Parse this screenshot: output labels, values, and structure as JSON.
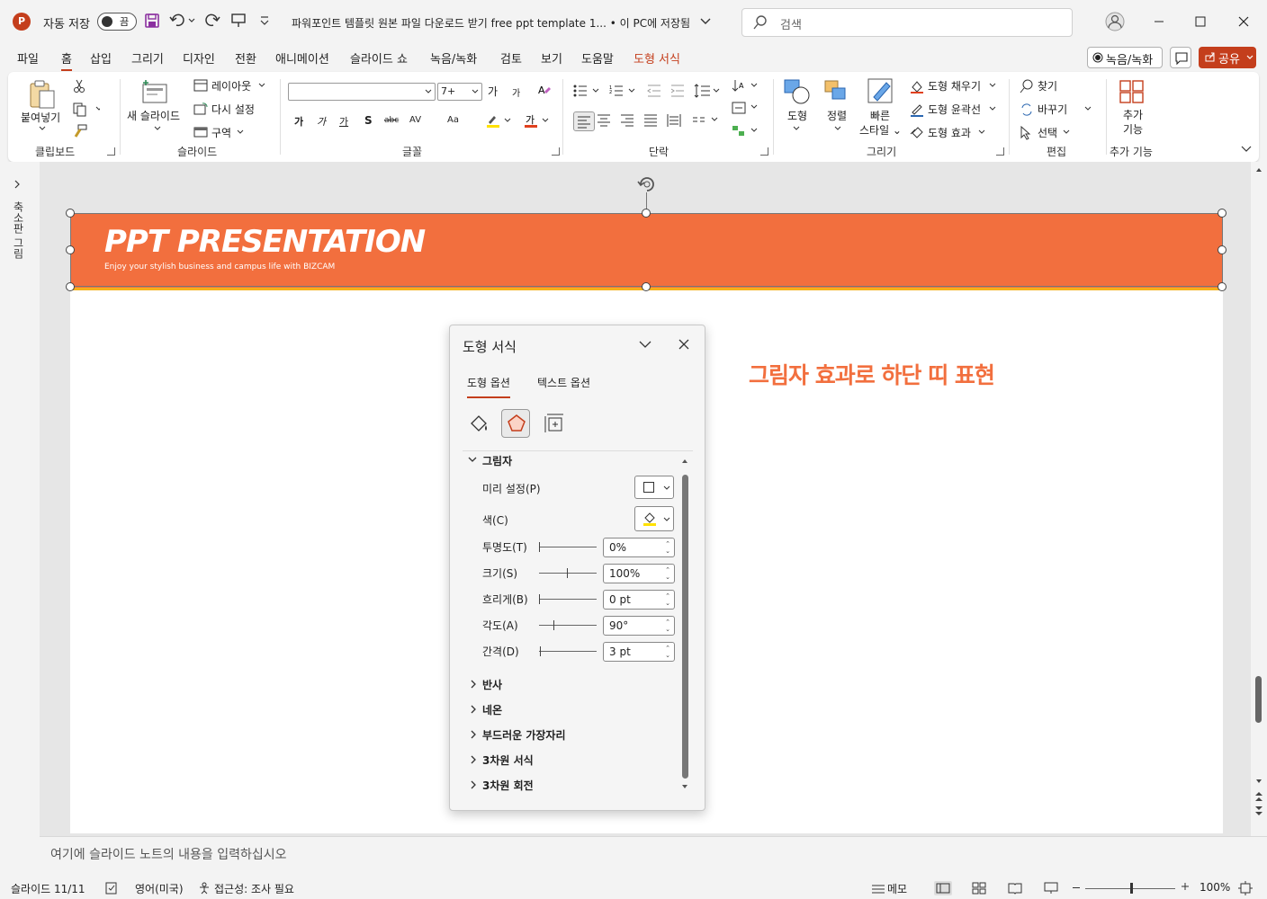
{
  "titlebar": {
    "app_icon": "P",
    "autosave_label": "자동 저장",
    "autosave_state": "끔",
    "doc_title": "파워포인트 템플릿 원본 파일 다운로드 받기 free ppt template 1... • 이 PC에 저장됨",
    "search_placeholder": "검색"
  },
  "menu": {
    "tabs": [
      "파일",
      "홈",
      "삽입",
      "그리기",
      "디자인",
      "전환",
      "애니메이션",
      "슬라이드 쇼",
      "녹음/녹화",
      "검토",
      "보기",
      "도움말",
      "도형 서식"
    ],
    "active_tab": "홈",
    "record_label": "녹음/녹화",
    "share_label": "공유"
  },
  "ribbon": {
    "clipboard": {
      "paste": "붙여넣기",
      "group": "클립보드"
    },
    "slides": {
      "new_slide": "새 슬라이드",
      "layout": "레이아웃",
      "reset": "다시 설정",
      "section": "구역",
      "group": "슬라이드"
    },
    "font": {
      "font_name": "",
      "font_size": "7+",
      "group": "글꼴",
      "bold": "가",
      "italic": "가",
      "underline": "가",
      "shadow": "S",
      "strike": "abc",
      "spacing": "AV",
      "case": "Aa",
      "grow": "가",
      "shrink": "가"
    },
    "paragraph": {
      "group": "단락"
    },
    "drawing": {
      "shapes": "도형",
      "arrange": "정렬",
      "quick_styles": "빠른 스타일",
      "fill": "도형 채우기",
      "outline": "도형 윤곽선",
      "effects": "도형 효과",
      "group": "그리기"
    },
    "editing": {
      "find": "찾기",
      "replace": "바꾸기",
      "select": "선택",
      "group": "편집"
    },
    "addins": {
      "button": "추가 기능",
      "group": "추가 기능"
    }
  },
  "thumb_panel_label": "축소판 그림",
  "slide": {
    "banner_title": "PPT PRESENTATION",
    "banner_subtitle": "Enjoy your stylish business and campus life with BIZCAM",
    "caption": "그림자 효과로 하단 띠 표현",
    "banner_color": "#f26f3e",
    "stripe_color": "#f5b01c"
  },
  "format_pane": {
    "title": "도형 서식",
    "tabs": [
      "도형 옵션",
      "텍스트 옵션"
    ],
    "active_tab": "도형 옵션",
    "shadow": {
      "header": "그림자",
      "preset_label": "미리 설정(P)",
      "color_label": "색(C)",
      "transparency": {
        "label": "투명도(T)",
        "value": "0%"
      },
      "size": {
        "label": "크기(S)",
        "value": "100%"
      },
      "blur": {
        "label": "흐리게(B)",
        "value": "0 pt"
      },
      "angle": {
        "label": "각도(A)",
        "value": "90°"
      },
      "distance": {
        "label": "간격(D)",
        "value": "3 pt"
      }
    },
    "sections": [
      "반사",
      "네온",
      "부드러운 가장자리",
      "3차원 서식",
      "3차원 회전"
    ]
  },
  "notes_placeholder": "여기에 슬라이드 노트의 내용을 입력하십시오",
  "statusbar": {
    "slide_info": "슬라이드 11/11",
    "language": "영어(미국)",
    "accessibility": "접근성: 조사 필요",
    "notes_label": "메모",
    "zoom": "100%"
  },
  "colors": {
    "accent": "#c43e1c",
    "caption": "#f26f3e"
  }
}
